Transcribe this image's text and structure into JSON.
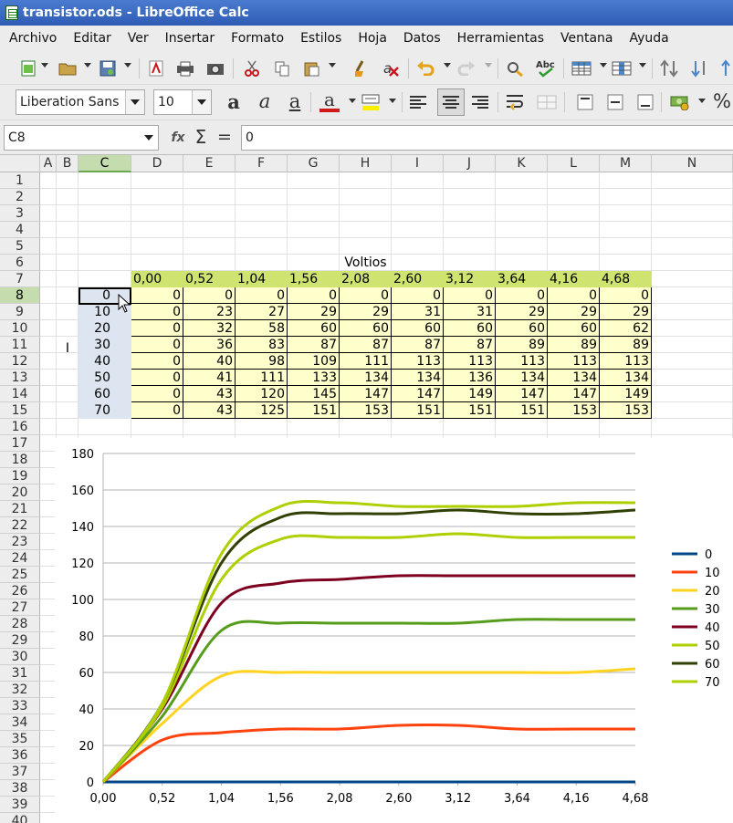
{
  "window": {
    "title": "transistor.ods - LibreOffice Calc"
  },
  "menu": [
    "Archivo",
    "Editar",
    "Ver",
    "Insertar",
    "Formato",
    "Estilos",
    "Hoja",
    "Datos",
    "Herramientas",
    "Ventana",
    "Ayuda"
  ],
  "format_toolbar": {
    "font_name": "Liberation Sans",
    "font_size": "10",
    "bold_glyph": "a",
    "italic_glyph": "a",
    "underline_glyph": "a",
    "font_color_glyph": "a",
    "percent_glyph": "%"
  },
  "formula_bar": {
    "name_box": "C8",
    "value": "0",
    "function_wizard_glyph": "fx",
    "sum_glyph": "Σ",
    "equals_glyph": "="
  },
  "columns": [
    "A",
    "B",
    "C",
    "D",
    "E",
    "F",
    "G",
    "H",
    "I",
    "J",
    "K",
    "L",
    "M",
    "N"
  ],
  "selected": {
    "column": "C",
    "row": "8"
  },
  "rows": [
    "1",
    "2",
    "3",
    "4",
    "5",
    "6",
    "7",
    "8",
    "9",
    "10",
    "11",
    "12",
    "13",
    "14",
    "15",
    "16",
    "17",
    "18",
    "19",
    "20",
    "21",
    "22",
    "23",
    "24",
    "25",
    "26",
    "27",
    "28",
    "29",
    "30",
    "31",
    "32",
    "33",
    "34",
    "35",
    "36",
    "37",
    "38",
    "39",
    "40"
  ],
  "table": {
    "header_title": "Voltios",
    "row_axis_label": "I",
    "voltages": [
      "0,00",
      "0,52",
      "1,04",
      "1,56",
      "2,08",
      "2,60",
      "3,12",
      "3,64",
      "4,16",
      "4,68"
    ],
    "currents": [
      "0",
      "10",
      "20",
      "30",
      "40",
      "50",
      "60",
      "70"
    ],
    "values": [
      [
        "0",
        "0",
        "0",
        "0",
        "0",
        "0",
        "0",
        "0",
        "0",
        "0"
      ],
      [
        "0",
        "23",
        "27",
        "29",
        "29",
        "31",
        "31",
        "29",
        "29",
        "29"
      ],
      [
        "0",
        "32",
        "58",
        "60",
        "60",
        "60",
        "60",
        "60",
        "60",
        "62"
      ],
      [
        "0",
        "36",
        "83",
        "87",
        "87",
        "87",
        "87",
        "89",
        "89",
        "89"
      ],
      [
        "0",
        "40",
        "98",
        "109",
        "111",
        "113",
        "113",
        "113",
        "113",
        "113"
      ],
      [
        "0",
        "41",
        "111",
        "133",
        "134",
        "134",
        "136",
        "134",
        "134",
        "134"
      ],
      [
        "0",
        "43",
        "120",
        "145",
        "147",
        "147",
        "149",
        "147",
        "147",
        "149"
      ],
      [
        "0",
        "43",
        "125",
        "151",
        "153",
        "151",
        "151",
        "151",
        "153",
        "153"
      ]
    ]
  },
  "chart_data": {
    "type": "line",
    "smooth": true,
    "x": [
      "0,00",
      "0,52",
      "1,04",
      "1,56",
      "2,08",
      "2,60",
      "3,12",
      "3,64",
      "4,16",
      "4,68"
    ],
    "ylim": [
      0,
      180
    ],
    "yticks": [
      "0",
      "20",
      "40",
      "60",
      "80",
      "100",
      "120",
      "140",
      "160",
      "180"
    ],
    "grid": "horizontal",
    "legend_position": "right",
    "series": [
      {
        "name": "0",
        "color": "#004586",
        "values": [
          0,
          0,
          0,
          0,
          0,
          0,
          0,
          0,
          0,
          0
        ]
      },
      {
        "name": "10",
        "color": "#ff420e",
        "values": [
          0,
          23,
          27,
          29,
          29,
          31,
          31,
          29,
          29,
          29
        ]
      },
      {
        "name": "20",
        "color": "#ffd320",
        "values": [
          0,
          32,
          58,
          60,
          60,
          60,
          60,
          60,
          60,
          62
        ]
      },
      {
        "name": "30",
        "color": "#579d1c",
        "values": [
          0,
          36,
          83,
          87,
          87,
          87,
          87,
          89,
          89,
          89
        ]
      },
      {
        "name": "40",
        "color": "#7e0021",
        "values": [
          0,
          40,
          98,
          109,
          111,
          113,
          113,
          113,
          113,
          113
        ]
      },
      {
        "name": "50",
        "color": "#aecf00",
        "values": [
          0,
          41,
          111,
          133,
          134,
          134,
          136,
          134,
          134,
          134
        ]
      },
      {
        "name": "60",
        "color": "#314004",
        "values": [
          0,
          43,
          120,
          145,
          147,
          147,
          149,
          147,
          147,
          149
        ]
      },
      {
        "name": "70",
        "color": "#aecf00",
        "values": [
          0,
          43,
          125,
          151,
          153,
          151,
          151,
          151,
          153,
          153
        ]
      }
    ]
  }
}
